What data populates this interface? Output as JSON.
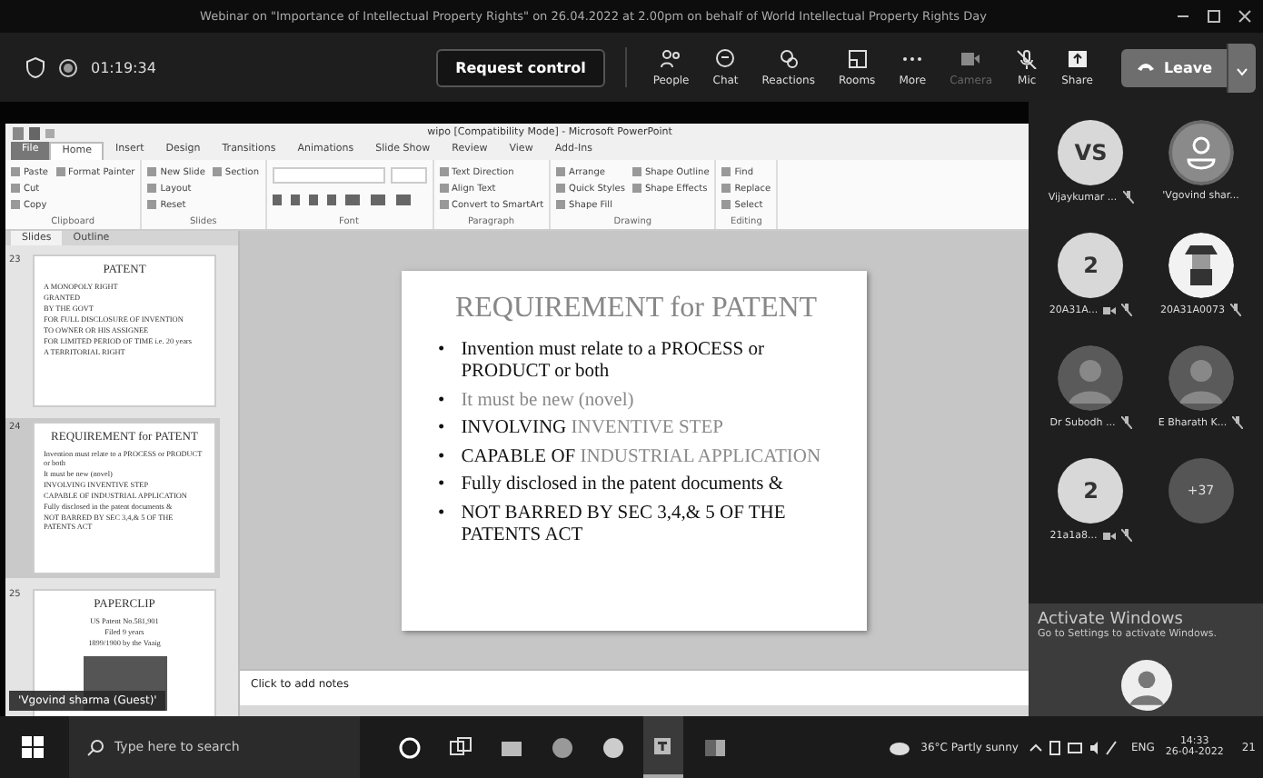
{
  "meeting_title": "Webinar on \"Importance of Intellectual Property Rights\" on 26.04.2022 at 2.00pm on behalf of World Intellectual Property Rights Day",
  "toolbar": {
    "timer": "01:19:34",
    "request_control": "Request control",
    "buttons": [
      {
        "kind": "people",
        "label": "People",
        "disabled": false
      },
      {
        "kind": "chat",
        "label": "Chat",
        "disabled": false
      },
      {
        "kind": "reactions",
        "label": "Reactions",
        "disabled": false
      },
      {
        "kind": "rooms",
        "label": "Rooms",
        "disabled": false
      },
      {
        "kind": "more",
        "label": "More",
        "disabled": false
      },
      {
        "kind": "camera",
        "label": "Camera",
        "disabled": true
      },
      {
        "kind": "mic",
        "label": "Mic",
        "disabled": false
      },
      {
        "kind": "share",
        "label": "Share",
        "disabled": false
      }
    ],
    "leave": "Leave"
  },
  "powerpoint": {
    "title": "wipo [Compatibility Mode] - Microsoft PowerPoint",
    "tabs": [
      {
        "label": "File",
        "kind": "file",
        "selected": false
      },
      {
        "label": "Home",
        "kind": "tab",
        "selected": true
      },
      {
        "label": "Insert",
        "kind": "tab",
        "selected": false
      },
      {
        "label": "Design",
        "kind": "tab",
        "selected": false
      },
      {
        "label": "Transitions",
        "kind": "tab",
        "selected": false
      },
      {
        "label": "Animations",
        "kind": "tab",
        "selected": false
      },
      {
        "label": "Slide Show",
        "kind": "tab",
        "selected": false
      },
      {
        "label": "Review",
        "kind": "tab",
        "selected": false
      },
      {
        "label": "View",
        "kind": "tab",
        "selected": false
      },
      {
        "label": "Add-Ins",
        "kind": "tab",
        "selected": false
      }
    ],
    "ribbon_groups": [
      {
        "label": "Clipboard",
        "kind": "list",
        "items": [
          "Paste",
          "Cut",
          "Copy",
          "Format Painter"
        ]
      },
      {
        "label": "Slides",
        "kind": "list",
        "items": [
          "New Slide",
          "Layout",
          "Reset",
          "Section"
        ]
      },
      {
        "label": "Font",
        "kind": "font"
      },
      {
        "label": "Paragraph",
        "kind": "list",
        "items": [
          "Text Direction",
          "Align Text",
          "Convert to SmartArt"
        ]
      },
      {
        "label": "Drawing",
        "kind": "list",
        "items": [
          "Arrange",
          "Quick Styles",
          "Shape Fill",
          "Shape Outline",
          "Shape Effects"
        ]
      },
      {
        "label": "Editing",
        "kind": "list",
        "items": [
          "Find",
          "Replace",
          "Select"
        ]
      }
    ],
    "pane_tabs": [
      {
        "label": "Slides",
        "selected": true
      },
      {
        "label": "Outline",
        "selected": false
      }
    ],
    "thumbnails": [
      {
        "number": "23",
        "selected": false,
        "title": "PATENT",
        "lines": [
          "A MONOPOLY RIGHT",
          "GRANTED",
          "BY THE GOVT",
          "FOR FULL DISCLOSURE OF INVENTION",
          "TO OWNER OR HIS ASSIGNEE",
          "FOR LIMITED PERIOD OF TIME i.e. 20 years",
          "A TERRITORIAL RIGHT"
        ],
        "picture": false
      },
      {
        "number": "24",
        "selected": true,
        "title": "REQUIREMENT for PATENT",
        "lines": [
          "Invention must relate to a PROCESS or PRODUCT or both",
          "It must be new (novel)",
          "INVOLVING INVENTIVE STEP",
          "CAPABLE OF INDUSTRIAL APPLICATION",
          "Fully disclosed in the patent documents &",
          "NOT BARRED BY SEC 3,4,& 5 OF THE PATENTS ACT"
        ],
        "picture": false
      },
      {
        "number": "25",
        "selected": false,
        "title": "PAPERCLIP",
        "lines": [
          "US Patent No.581,901",
          "Filed 9 years",
          "1899/1900 by the Vaaig"
        ],
        "picture": true
      }
    ],
    "slide": {
      "title": "REQUIREMENT for PATENT",
      "bullets": [
        {
          "marker": "•",
          "segments": [
            {
              "text": "Invention must relate to a PROCESS or PRODUCT or both",
              "faded": false
            }
          ]
        },
        {
          "marker": "•",
          "segments": [
            {
              "text": "It must be new (novel)",
              "faded": true
            }
          ]
        },
        {
          "marker": "•",
          "segments": [
            {
              "text": "INVOLVING ",
              "faded": false
            },
            {
              "text": "INVENTIVE STEP",
              "faded": true
            }
          ]
        },
        {
          "marker": "•",
          "segments": [
            {
              "text": "CAPABLE OF ",
              "faded": false
            },
            {
              "text": "INDUSTRIAL APPLICATION",
              "faded": true
            }
          ]
        },
        {
          "marker": "•",
          "segments": [
            {
              "text": "Fully disclosed in the patent documents &",
              "faded": false
            }
          ]
        },
        {
          "marker": "•",
          "segments": [
            {
              "text": "NOT BARRED BY SEC 3,4,& 5 OF THE PATENTS ACT",
              "faded": false
            }
          ]
        }
      ]
    },
    "notes_placeholder": "Click to add notes"
  },
  "presenter_tag": "'Vgovind sharma (Guest)'",
  "participants": [
    {
      "kind": "initials",
      "initials": "VS",
      "name": "Vijaykumar ...",
      "muted": true,
      "camera_off": false
    },
    {
      "kind": "silhouette",
      "name": "'Vgovind shar...",
      "muted": false,
      "camera_off": false
    },
    {
      "kind": "initials",
      "initials": "2",
      "name": "20A31A...",
      "muted": true,
      "camera_off": true
    },
    {
      "kind": "cartoon",
      "name": "20A31A0073",
      "muted": true,
      "camera_off": false
    },
    {
      "kind": "photo",
      "name": "Dr Subodh ...",
      "muted": true,
      "camera_off": false
    },
    {
      "kind": "photo",
      "name": "E Bharath K...",
      "muted": true,
      "camera_off": false
    },
    {
      "kind": "initials",
      "initials": "2",
      "name": "21a1a8...",
      "muted": true,
      "camera_off": true
    },
    {
      "kind": "overflow",
      "initials": "+37"
    }
  ],
  "activation": {
    "title": "Activate Windows",
    "subtitle": "Go to Settings to activate Windows."
  },
  "taskbar": {
    "search_placeholder": "Type here to search",
    "apps": [
      {
        "kind": "cortana",
        "selected": false
      },
      {
        "kind": "taskview",
        "selected": false
      },
      {
        "kind": "folder",
        "selected": false
      },
      {
        "kind": "chrome",
        "selected": false
      },
      {
        "kind": "edge",
        "selected": false
      },
      {
        "kind": "teams",
        "selected": true
      },
      {
        "kind": "word",
        "selected": false
      }
    ],
    "weather": "36°C  Partly sunny",
    "language": "ENG",
    "time": "14:33",
    "date": "26-04-2022",
    "notifications": "21"
  }
}
